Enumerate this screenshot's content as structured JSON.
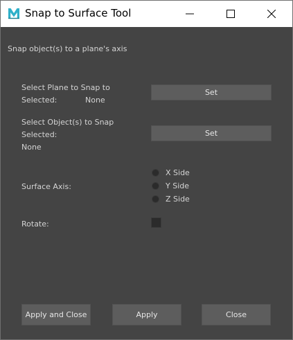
{
  "window": {
    "title": "Snap to Surface Tool",
    "app_icon": "maya-logo-icon",
    "controls": [
      "minimize-icon",
      "maximize-icon",
      "close-icon"
    ]
  },
  "main": {
    "description": "Snap object(s) to a plane's axis",
    "plane": {
      "label": "Select Plane to Snap to",
      "selected_label": "Selected:",
      "selected_value": "None",
      "button": "Set"
    },
    "objects": {
      "label": "Select Object(s) to Snap",
      "selected_label": "Selected:",
      "selected_value": "None",
      "button": "Set"
    },
    "surface_axis": {
      "label": "Surface Axis:",
      "options": [
        "X Side",
        "Y Side",
        "Z Side"
      ]
    },
    "rotate": {
      "label": "Rotate:",
      "checked": false
    }
  },
  "footer": {
    "apply_close": "Apply and Close",
    "apply": "Apply",
    "close": "Close"
  },
  "colors": {
    "background": "#444444",
    "button": "#5d5d5d",
    "text": "#d4d4d4",
    "titlebar": "#ffffff",
    "logo": "#2fb0c9"
  }
}
